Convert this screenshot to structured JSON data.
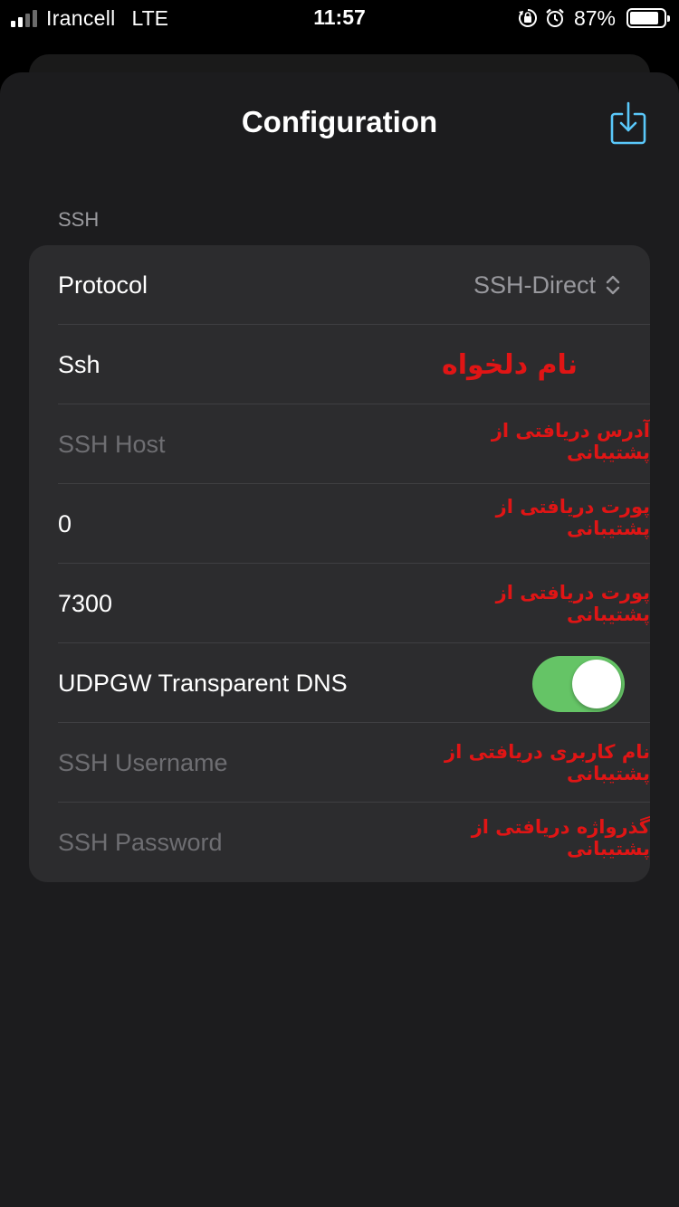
{
  "status_bar": {
    "carrier": "Irancell",
    "network": "LTE",
    "time": "11:57",
    "battery_percent": "87%",
    "battery_level": 0.87,
    "icons": [
      "orientation-lock-icon",
      "alarm-icon"
    ]
  },
  "header": {
    "title": "Configuration",
    "export_icon": "share-download-icon",
    "accent_color": "#5ac8fa"
  },
  "section": {
    "title": "SSH"
  },
  "rows": {
    "protocol": {
      "label": "Protocol",
      "value": "SSH-Direct"
    },
    "name": {
      "value": "Ssh",
      "note": "نام دلخواه"
    },
    "host": {
      "placeholder": "SSH Host",
      "note": "آدرس دریافتی از پشتیبانی"
    },
    "port": {
      "value": "0",
      "note": "پورت دریافتی از پشتیبانی"
    },
    "udpgw_port": {
      "value": "7300",
      "note": "پورت دریافتی از پشتیبانی"
    },
    "udpgw_dns": {
      "label": "UDPGW Transparent DNS",
      "enabled": true,
      "color": "#65c466"
    },
    "username": {
      "placeholder": "SSH Username",
      "note": "نام کاربری دریافتی از پشتیبانی"
    },
    "password": {
      "placeholder": "SSH Password",
      "note": "گذرواژه دریافتی از پشتیبانی"
    }
  }
}
